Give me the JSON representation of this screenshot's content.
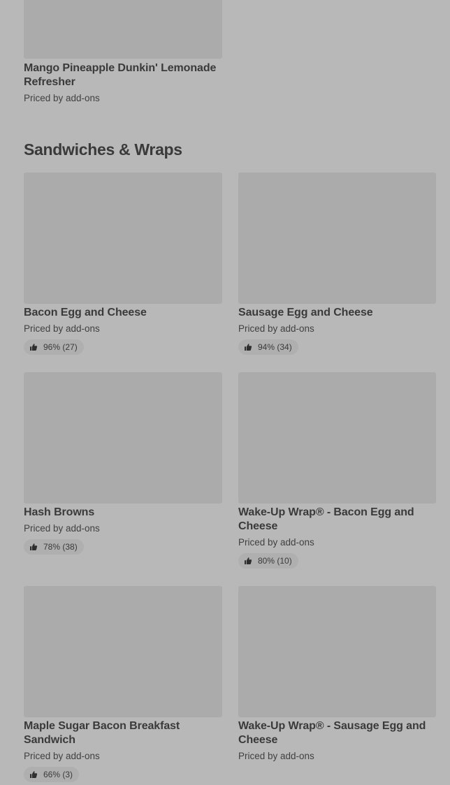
{
  "top_item": {
    "title": "Mango Pineapple Dunkin' Lemonade Refresher",
    "subtitle": "Priced by add-ons"
  },
  "section": {
    "title": "Sandwiches & Wraps"
  },
  "items": [
    {
      "title": "Bacon Egg and Cheese",
      "subtitle": "Priced by add-ons",
      "rating": "96% (27)"
    },
    {
      "title": "Sausage Egg and Cheese",
      "subtitle": "Priced by add-ons",
      "rating": "94% (34)"
    },
    {
      "title": "Hash Browns",
      "subtitle": "Priced by add-ons",
      "rating": "78% (38)"
    },
    {
      "title": "Wake-Up Wrap® - Bacon Egg and Cheese",
      "subtitle": "Priced by add-ons",
      "rating": "80% (10)"
    },
    {
      "title": "Maple Sugar Bacon Breakfast Sandwich",
      "subtitle": "Priced by add-ons",
      "rating": "66% (3)"
    },
    {
      "title": "Wake-Up Wrap® - Sausage Egg and Cheese",
      "subtitle": "Priced by add-ons"
    }
  ],
  "icons": {
    "rating_icon": "thumbs-up-icon"
  },
  "colors": {
    "background": "#b8b8b8",
    "image_placeholder": "#ababab",
    "rating_pill": "#afafaf",
    "text": "#3a3a3a"
  }
}
